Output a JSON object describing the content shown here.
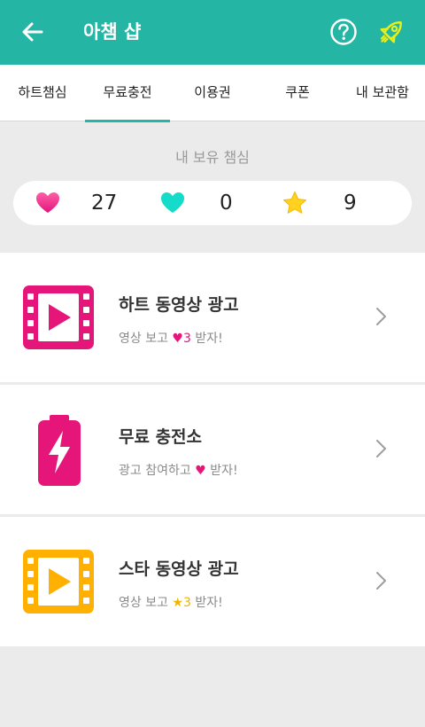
{
  "appbar": {
    "title": "아챔 샵",
    "back_icon": "arrow-left-icon",
    "help_icon": "question-circle-icon",
    "rocket_icon": "rocket-icon",
    "colors": {
      "bar": "#25b5a4",
      "rocket": "#e8f01a"
    }
  },
  "tabs": [
    {
      "label": "하트챔심",
      "active": false
    },
    {
      "label": "무료충전",
      "active": true
    },
    {
      "label": "이용권",
      "active": false
    },
    {
      "label": "쿠폰",
      "active": false
    },
    {
      "label": "내 보관함",
      "active": false
    }
  ],
  "balance": {
    "label": "내 보유 챔심",
    "items": [
      {
        "icon": "pink-heart-icon",
        "value": "27"
      },
      {
        "icon": "teal-heart-icon",
        "value": "0"
      },
      {
        "icon": "star-icon",
        "value": "9"
      }
    ]
  },
  "offers": [
    {
      "title": "하트 동영상 광고",
      "sub_prefix": "영상 보고 ",
      "sub_icon": "♥",
      "sub_count": "3",
      "sub_suffix": " 받자!",
      "icon": "film-play-icon",
      "color": "#e6157a"
    },
    {
      "title": "무료 충전소",
      "sub_prefix": "광고 참여하고 ",
      "sub_icon": "♥",
      "sub_count": "",
      "sub_suffix": " 받자!",
      "icon": "battery-charge-icon",
      "color": "#e6157a"
    },
    {
      "title": "스타 동영상 광고",
      "sub_prefix": "영상 보고 ",
      "sub_icon": "★",
      "sub_count": "3",
      "sub_suffix": " 받자!",
      "icon": "film-play-icon",
      "color": "#ffb000"
    }
  ]
}
